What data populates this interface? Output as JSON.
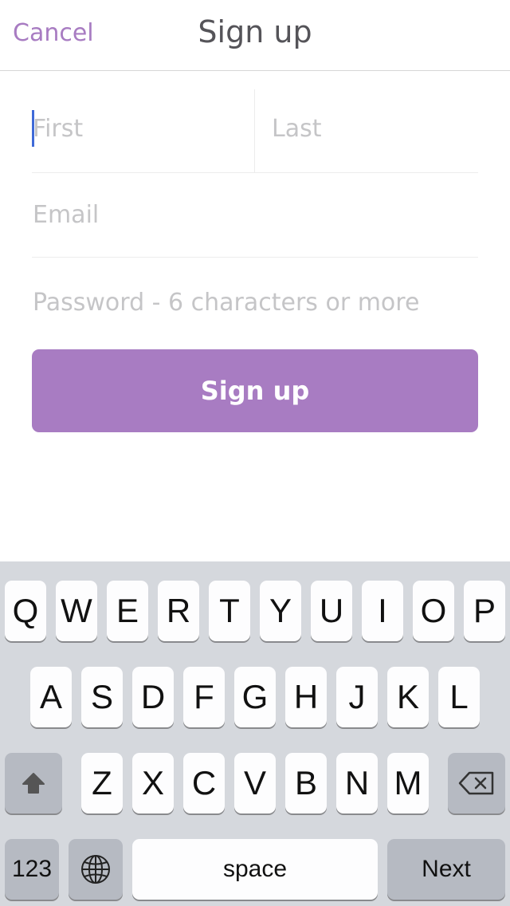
{
  "nav": {
    "cancel_label": "Cancel",
    "title": "Sign up"
  },
  "form": {
    "first_placeholder": "First",
    "last_placeholder": "Last",
    "email_placeholder": "Email",
    "password_placeholder": "Password - 6 characters or more",
    "submit_label": "Sign up"
  },
  "colors": {
    "accent": "#a87cc2",
    "caret": "#3f6ad8",
    "keyboard_bg": "#d5d8dd"
  },
  "keyboard": {
    "row1": [
      "Q",
      "W",
      "E",
      "R",
      "T",
      "Y",
      "U",
      "I",
      "O",
      "P"
    ],
    "row2": [
      "A",
      "S",
      "D",
      "F",
      "G",
      "H",
      "J",
      "K",
      "L"
    ],
    "row3": [
      "Z",
      "X",
      "C",
      "V",
      "B",
      "N",
      "M"
    ],
    "shift_icon": "shift-arrow-icon",
    "delete_icon": "backspace-icon",
    "numbers_label": "123",
    "globe_icon": "globe-icon",
    "space_label": "space",
    "return_label": "Next"
  }
}
